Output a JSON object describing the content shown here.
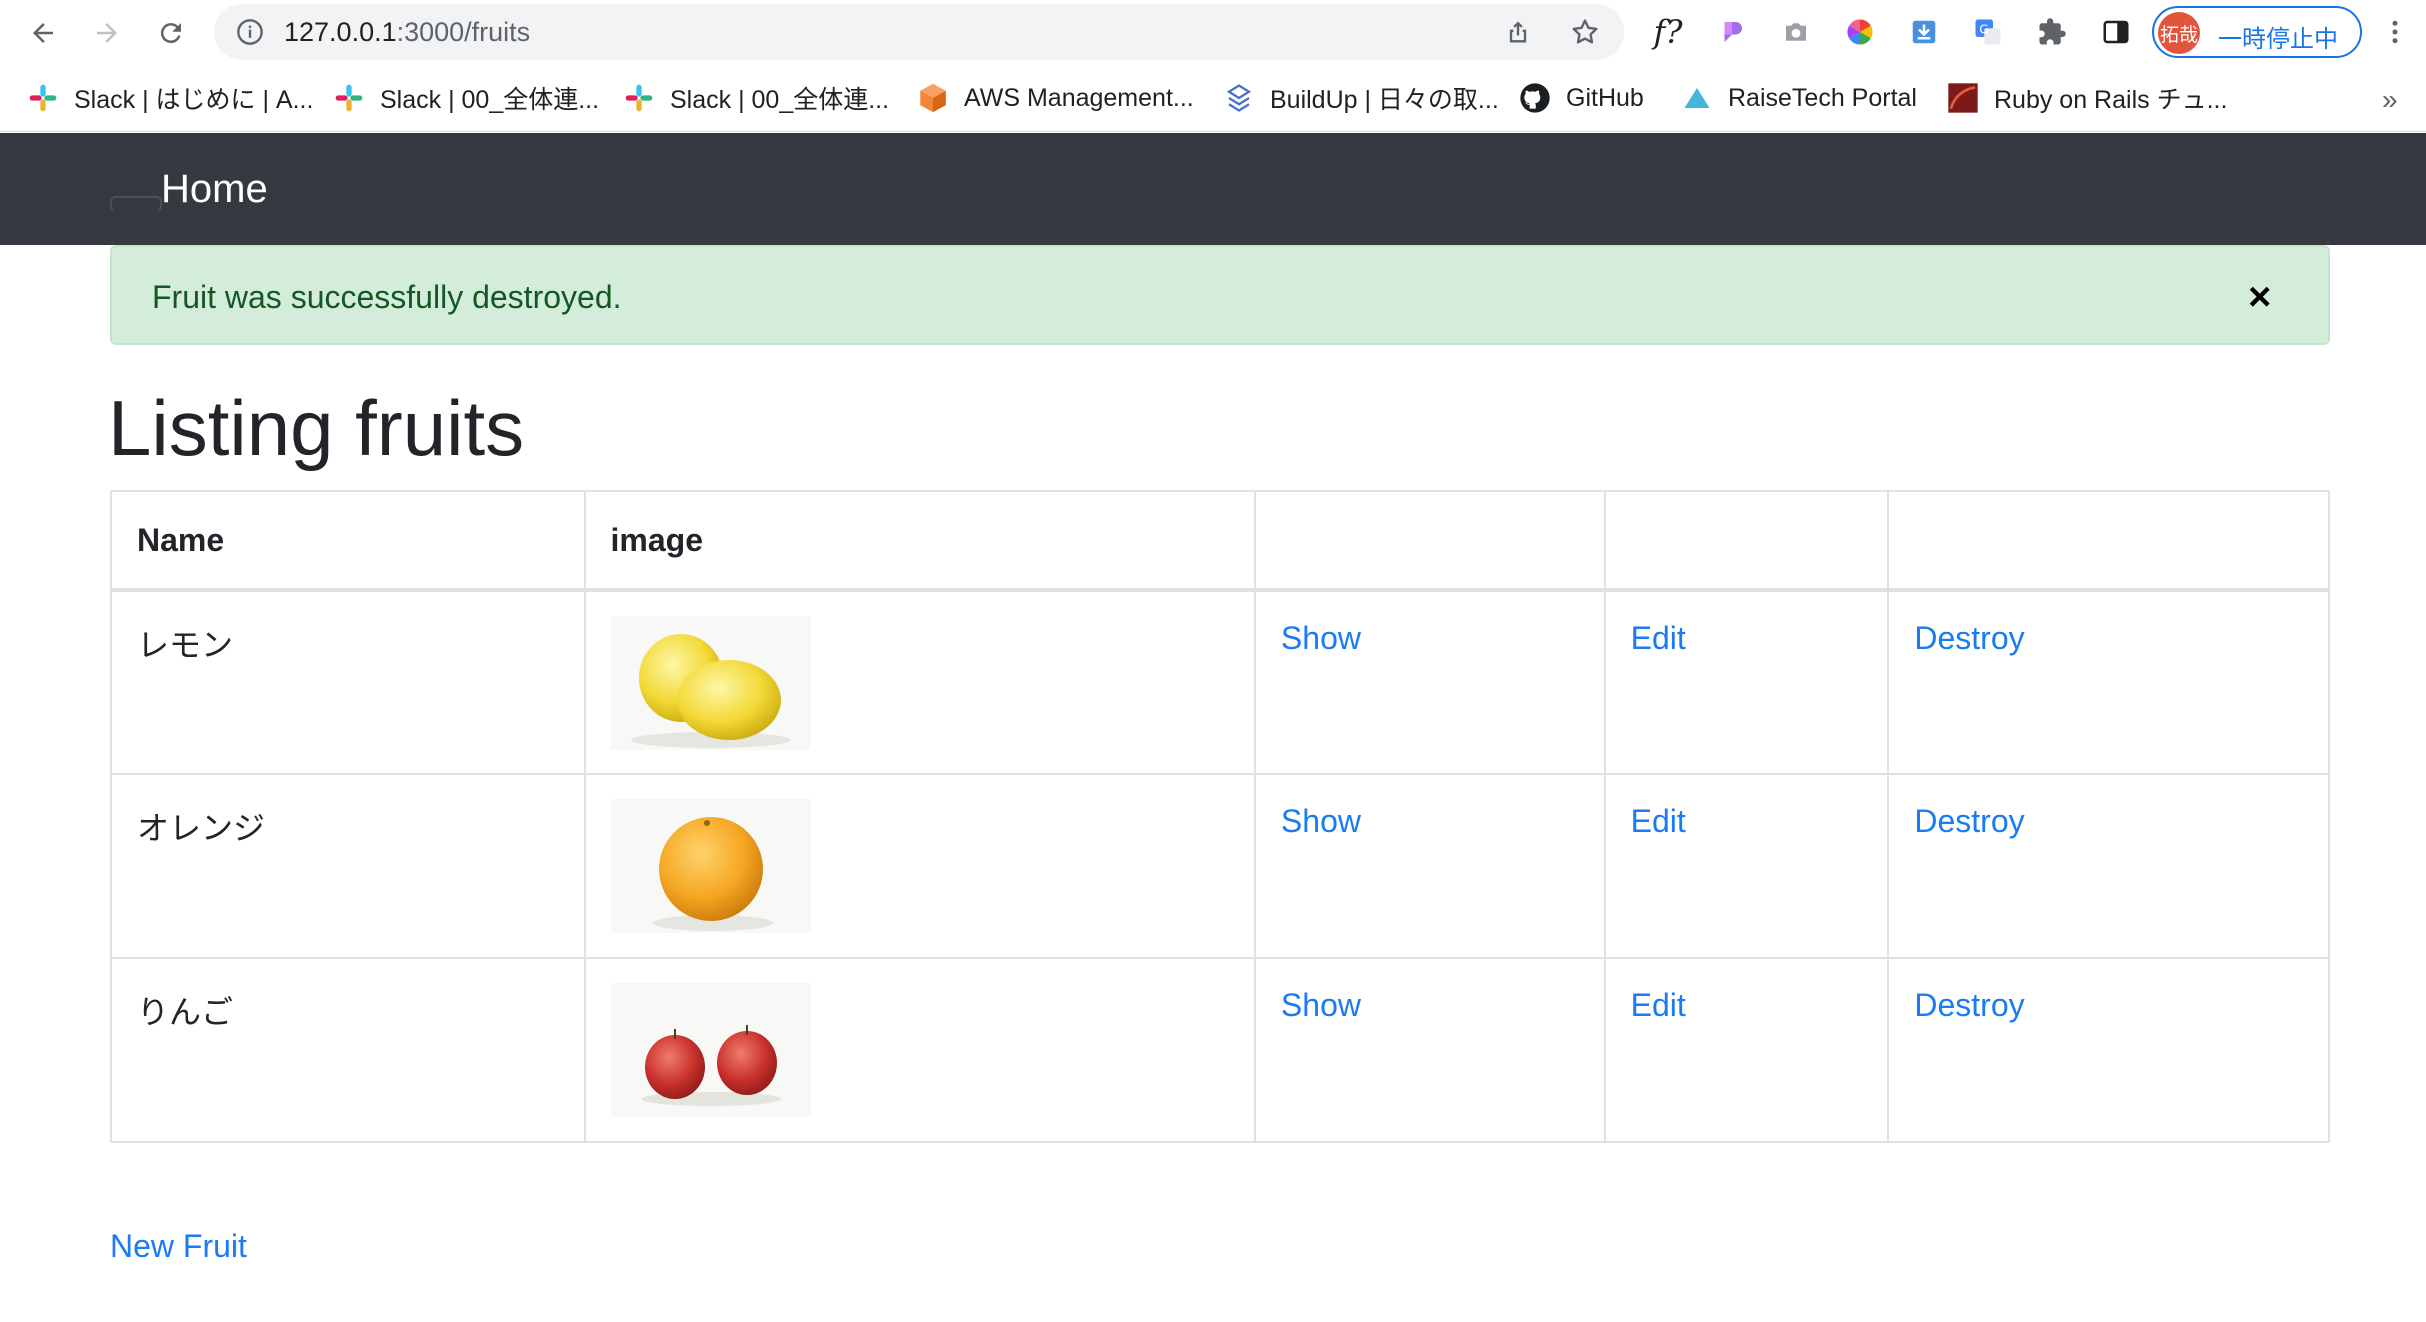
{
  "browser": {
    "url_host": "127.0.0.1",
    "url_path": ":3000/fruits",
    "profile_avatar_text": "拓哉",
    "profile_label": "一時停止中",
    "ext_f_label": "f?",
    "bookmarks": [
      {
        "label": "Slack | はじめに | A...",
        "icon": "slack-icon"
      },
      {
        "label": "Slack | 00_全体連...",
        "icon": "slack-icon"
      },
      {
        "label": "Slack | 00_全体連...",
        "icon": "slack-icon"
      },
      {
        "label": "AWS Management...",
        "icon": "aws-icon"
      },
      {
        "label": "BuildUp | 日々の取...",
        "icon": "buildup-icon"
      },
      {
        "label": "GitHub",
        "icon": "github-icon"
      },
      {
        "label": "RaiseTech Portal",
        "icon": "raisetech-icon"
      },
      {
        "label": "Ruby on Rails チュ...",
        "icon": "rails-icon"
      }
    ],
    "bookmarks_more": "»"
  },
  "navbar": {
    "brand": "Home"
  },
  "alert": {
    "message": "Fruit was successfully destroyed.",
    "close": "×"
  },
  "page": {
    "title": "Listing fruits",
    "new_link": "New Fruit"
  },
  "table": {
    "headers": [
      "Name",
      "image",
      "",
      "",
      ""
    ],
    "rows": [
      {
        "name": "レモン",
        "image": "lemon-image",
        "show": "Show",
        "edit": "Edit",
        "destroy": "Destroy"
      },
      {
        "name": "オレンジ",
        "image": "orange-image",
        "show": "Show",
        "edit": "Edit",
        "destroy": "Destroy"
      },
      {
        "name": "りんご",
        "image": "apple-image",
        "show": "Show",
        "edit": "Edit",
        "destroy": "Destroy"
      }
    ]
  },
  "colors": {
    "navbar_bg": "#343a40",
    "alert_bg": "#d4edda",
    "alert_text": "#155724",
    "link": "#1a7bf2",
    "profile_accent": "#1a73e8"
  }
}
